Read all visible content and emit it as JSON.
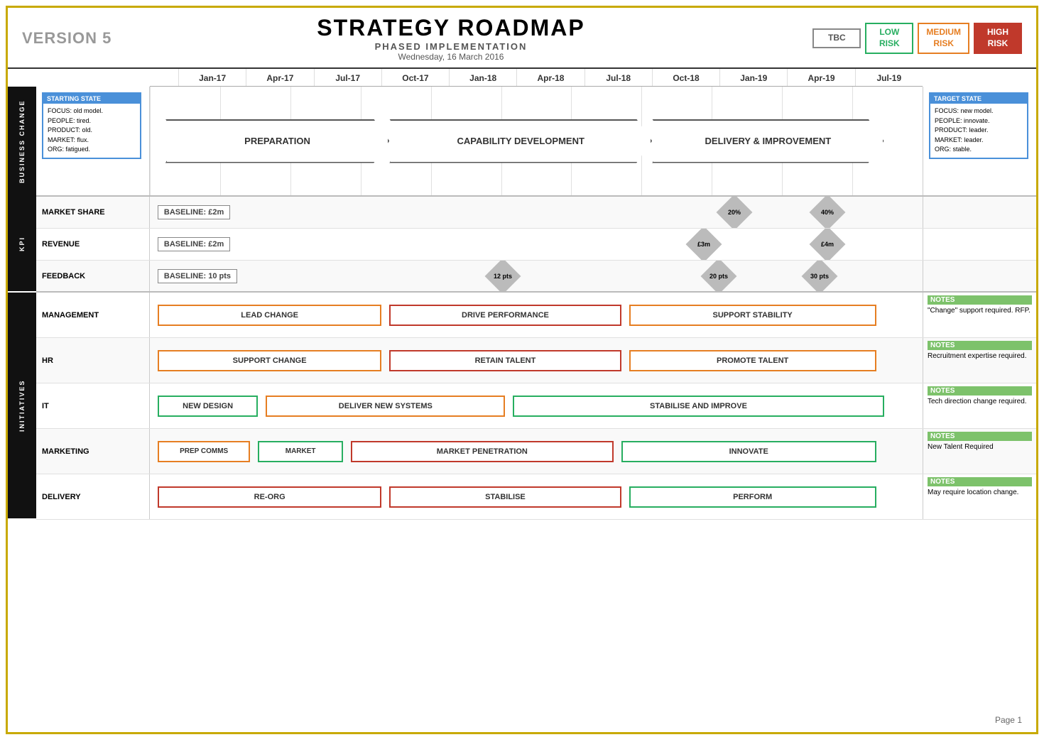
{
  "header": {
    "version": "VERSION 5",
    "title": "STRATEGY ROADMAP",
    "subtitle": "PHASED IMPLEMENTATION",
    "date": "Wednesday, 16 March 2016",
    "risk_labels": {
      "tbc": "TBC",
      "low": "LOW\nRISK",
      "medium": "MEDIUM\nRISK",
      "high": "HIGH\nRISK"
    }
  },
  "timeline": {
    "columns": [
      "Jan-17",
      "Apr-17",
      "Jul-17",
      "Oct-17",
      "Jan-18",
      "Apr-18",
      "Jul-18",
      "Oct-18",
      "Jan-19",
      "Apr-19",
      "Jul-19"
    ]
  },
  "sections": {
    "business_change": "BUSINESS CHANGE",
    "kpi": "KPI",
    "initiatives": "INITIATIVES"
  },
  "row_labels": {
    "market_share": "MARKET SHARE",
    "revenue": "REVENUE",
    "feedback": "FEEDBACK",
    "management": "MANAGEMENT",
    "hr": "HR",
    "it": "IT",
    "marketing": "MARKETING",
    "delivery": "DELIVERY"
  },
  "business_phases": {
    "preparation": "PREPARATION",
    "capability": "CAPABILITY DEVELOPMENT",
    "delivery": "DELIVERY & IMPROVEMENT"
  },
  "starting_state": {
    "title": "STARTING STATE",
    "focus": "FOCUS: old model.",
    "people": "PEOPLE: tired.",
    "product": "PRODUCT: old.",
    "market": "MARKET: flux.",
    "org": "ORG: fatigued."
  },
  "target_state": {
    "title": "TARGET STATE",
    "focus": "FOCUS: new model.",
    "people": "PEOPLE: innovate.",
    "product": "PRODUCT: leader.",
    "market": "MARKET: leader.",
    "org": "ORG: stable."
  },
  "kpi_data": {
    "market_share": {
      "baseline": "BASELINE: £2m",
      "milestone1": "20%",
      "milestone2": "40%"
    },
    "revenue": {
      "baseline": "BASELINE: £2m",
      "milestone1": "£3m",
      "milestone2": "£4m"
    },
    "feedback": {
      "baseline": "BASELINE: 10 pts",
      "milestone1": "12 pts",
      "milestone2": "20 pts",
      "milestone3": "30 pts"
    }
  },
  "initiatives": {
    "management": [
      {
        "label": "LEAD CHANGE",
        "color": "orange",
        "start_pct": 0,
        "width_pct": 31
      },
      {
        "label": "DRIVE PERFORMANCE",
        "color": "red",
        "start_pct": 32,
        "width_pct": 30
      },
      {
        "label": "SUPPORT STABILITY",
        "color": "orange",
        "start_pct": 64,
        "width_pct": 32
      }
    ],
    "hr": [
      {
        "label": "SUPPORT CHANGE",
        "color": "orange",
        "start_pct": 0,
        "width_pct": 31
      },
      {
        "label": "RETAIN TALENT",
        "color": "red",
        "start_pct": 32,
        "width_pct": 30
      },
      {
        "label": "PROMOTE TALENT",
        "color": "orange",
        "start_pct": 64,
        "width_pct": 32
      }
    ],
    "it": [
      {
        "label": "NEW DESIGN",
        "color": "green",
        "start_pct": 0,
        "width_pct": 14
      },
      {
        "label": "DELIVER NEW SYSTEMS",
        "color": "orange",
        "start_pct": 15,
        "width_pct": 31
      },
      {
        "label": "STABILISE AND IMPROVE",
        "color": "green",
        "start_pct": 48,
        "width_pct": 48
      }
    ],
    "marketing": [
      {
        "label": "PREP COMMS",
        "color": "orange",
        "start_pct": 0,
        "width_pct": 13
      },
      {
        "label": "MARKET",
        "color": "green",
        "start_pct": 15,
        "width_pct": 11
      },
      {
        "label": "MARKET PENETRATION",
        "color": "red",
        "start_pct": 28,
        "width_pct": 32
      },
      {
        "label": "INNOVATE",
        "color": "green",
        "start_pct": 62,
        "width_pct": 34
      }
    ],
    "delivery": [
      {
        "label": "RE-ORG",
        "color": "red",
        "start_pct": 0,
        "width_pct": 31
      },
      {
        "label": "STABILISE",
        "color": "red",
        "start_pct": 32,
        "width_pct": 30
      },
      {
        "label": "PERFORM",
        "color": "green",
        "start_pct": 64,
        "width_pct": 32
      }
    ]
  },
  "notes": {
    "management": {
      "label": "NOTES",
      "text": "\"Change\" support required. RFP."
    },
    "hr": {
      "label": "NOTES",
      "text": "Recruitment expertise required."
    },
    "it": {
      "label": "NOTES",
      "text": "Tech direction change required."
    },
    "marketing": {
      "label": "NOTES",
      "text": "New Talent Required"
    },
    "delivery": {
      "label": "NOTES",
      "text": "May require location change."
    }
  },
  "page": "Page 1"
}
